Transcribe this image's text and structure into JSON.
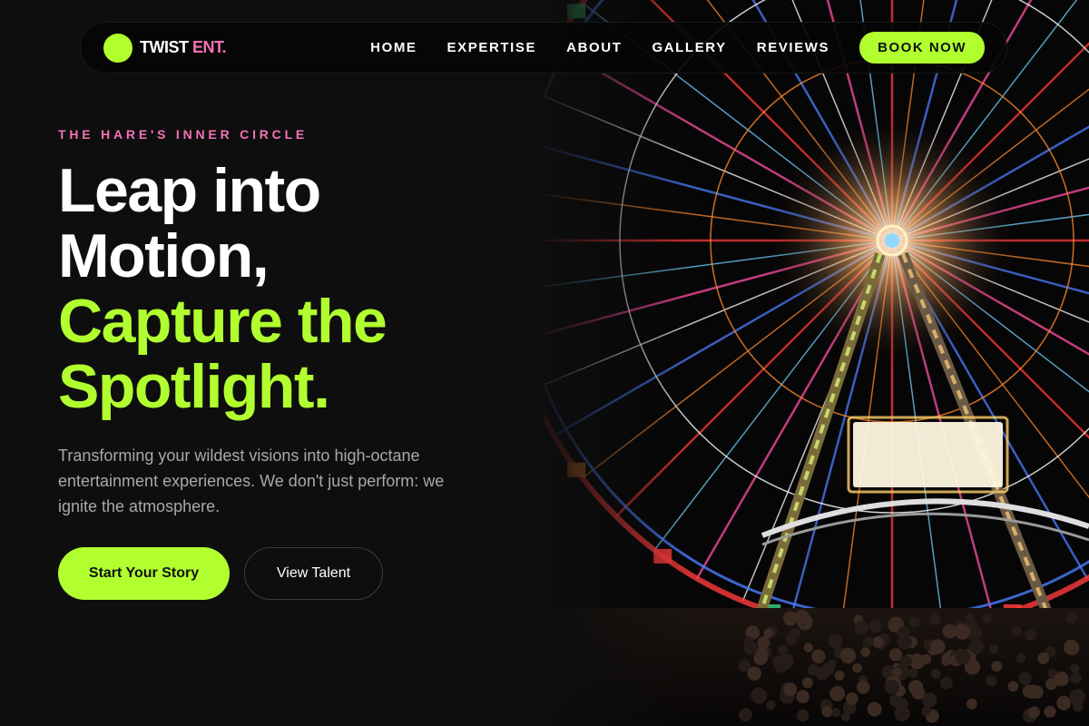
{
  "nav": {
    "logo_text": "TWIST",
    "logo_accent": "ENT.",
    "links": [
      "HOME",
      "EXPERTISE",
      "ABOUT",
      "GALLERY",
      "REVIEWS"
    ],
    "cta": "BOOK NOW"
  },
  "hero": {
    "eyebrow": "THE HARE'S INNER CIRCLE",
    "headline_lines": [
      "Leap into",
      "Motion,",
      "Capture the",
      "Spotlight."
    ],
    "description": "Transforming your wildest visions into high-octane entertainment experiences. We don't just perform: we ignite the atmosphere.",
    "primary_cta": "Start Your Story",
    "secondary_cta": "View Talent"
  },
  "colors": {
    "background": "#0e0e0e",
    "accent_green": "#b1ff2e",
    "accent_pink": "#f472b6",
    "muted_text": "#a9a9a9"
  },
  "icons": {
    "logo": "green-circle-logo-icon"
  },
  "image": {
    "subject": "illuminated ferris wheel at night with crowd"
  }
}
